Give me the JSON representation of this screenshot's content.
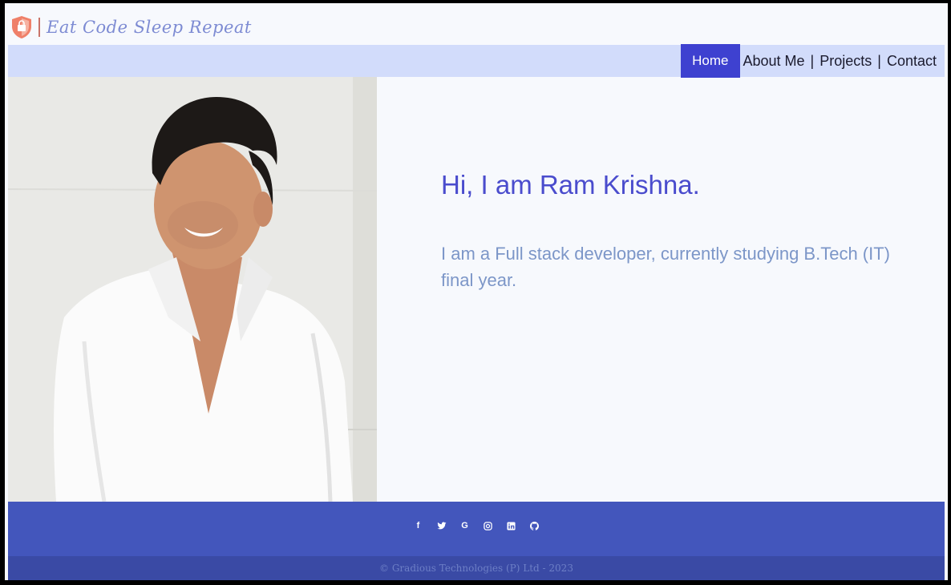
{
  "brand": {
    "name": "Eat Code Sleep Repeat",
    "logo_icon": "shield-icon",
    "logo_color": "#e8765c"
  },
  "nav": {
    "items": [
      {
        "label": "Home",
        "active": true
      },
      {
        "label": "About  Me"
      },
      {
        "label": "Projects"
      },
      {
        "label": "Contact"
      }
    ],
    "separator": "|",
    "active_color": "#3e41d0"
  },
  "hero": {
    "photo_icon": "profile-photo",
    "heading": "Hi, I am Ram Krishna.",
    "description": "I am a Full stack developer, currently studying B.Tech (IT) final year."
  },
  "footer": {
    "social": [
      {
        "glyph": "f",
        "icon": "facebook-icon"
      },
      {
        "glyph": "🐦",
        "icon": "twitter-icon"
      },
      {
        "glyph": "G",
        "icon": "google-icon"
      },
      {
        "glyph": "◎",
        "icon": "instagram-icon"
      },
      {
        "glyph": "in",
        "icon": "linkedin-icon"
      },
      {
        "glyph": "⌾",
        "icon": "github-icon"
      }
    ],
    "copyright": "© Gradious Technologies (P) Ltd - 2023"
  }
}
